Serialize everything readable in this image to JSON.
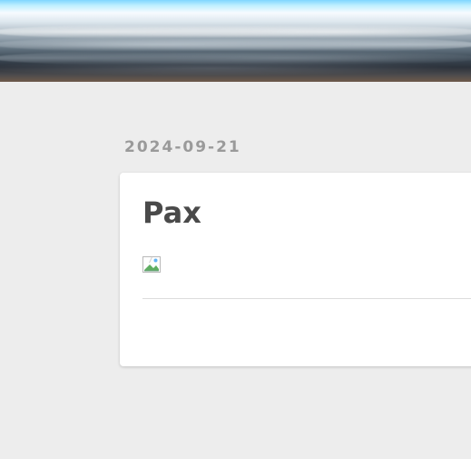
{
  "header": {
    "banner_image": "clouds-banner"
  },
  "post": {
    "date": "2024-09-21",
    "title": "Pax",
    "image": "broken-image-icon"
  }
}
